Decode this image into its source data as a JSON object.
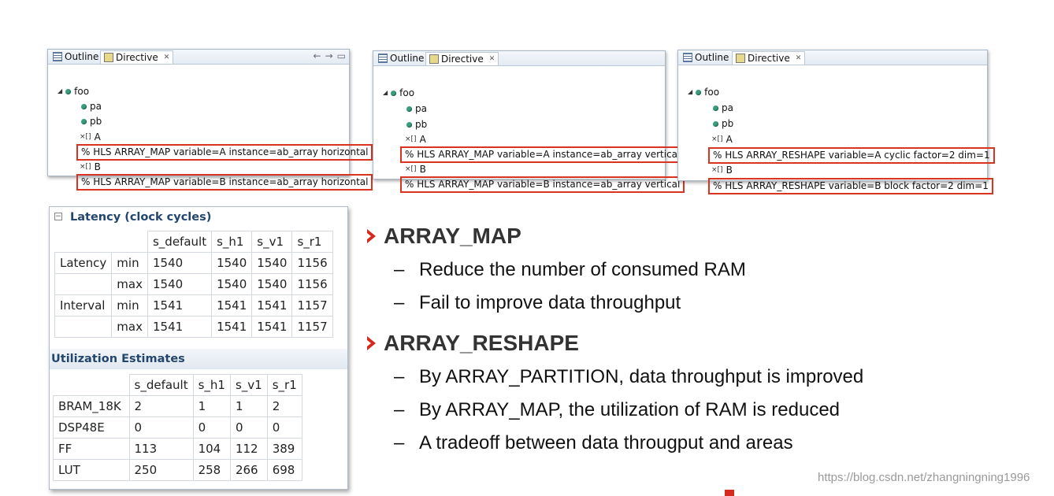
{
  "directive_panels": [
    {
      "tabs": {
        "outline": "Outline",
        "directive": "Directive"
      },
      "tree": {
        "function": "foo",
        "ports": [
          "pa",
          "pb"
        ],
        "array_a": "A",
        "array_b": "B"
      },
      "directives": [
        "HLS ARRAY_MAP variable=A instance=ab_array horizontal",
        "HLS ARRAY_MAP variable=B instance=ab_array horizontal"
      ]
    },
    {
      "tabs": {
        "outline": "Outline",
        "directive": "Directive"
      },
      "tree": {
        "function": "foo",
        "ports": [
          "pa",
          "pb"
        ],
        "array_a": "A",
        "array_b": "B"
      },
      "directives": [
        "HLS ARRAY_MAP variable=A instance=ab_array vertical",
        "HLS ARRAY_MAP variable=B instance=ab_array vertical"
      ]
    },
    {
      "tabs": {
        "outline": "Outline",
        "directive": "Directive"
      },
      "tree": {
        "function": "foo",
        "ports": [
          "pa",
          "pb"
        ],
        "array_a": "A",
        "array_b": "B"
      },
      "directives": [
        "HLS ARRAY_RESHAPE variable=A cyclic factor=2 dim=1",
        "HLS ARRAY_RESHAPE variable=B block factor=2 dim=1"
      ]
    }
  ],
  "latency": {
    "title": "Latency (clock cycles)",
    "columns": [
      "s_default",
      "s_h1",
      "s_v1",
      "s_r1"
    ],
    "rows": [
      {
        "group": "Latency",
        "sub": "min",
        "values": [
          "1540",
          "1540",
          "1540",
          "1156"
        ]
      },
      {
        "group": "",
        "sub": "max",
        "values": [
          "1540",
          "1540",
          "1540",
          "1156"
        ]
      },
      {
        "group": "Interval",
        "sub": "min",
        "values": [
          "1541",
          "1541",
          "1541",
          "1157"
        ]
      },
      {
        "group": "",
        "sub": "max",
        "values": [
          "1541",
          "1541",
          "1541",
          "1157"
        ]
      }
    ]
  },
  "utilization": {
    "title": "Utilization Estimates",
    "columns": [
      "s_default",
      "s_h1",
      "s_v1",
      "s_r1"
    ],
    "rows": [
      {
        "name": "BRAM_18K",
        "values": [
          "2",
          "1",
          "1",
          "2"
        ]
      },
      {
        "name": "DSP48E",
        "values": [
          "0",
          "0",
          "0",
          "0"
        ]
      },
      {
        "name": "FF",
        "values": [
          "113",
          "104",
          "112",
          "389"
        ]
      },
      {
        "name": "LUT",
        "values": [
          "250",
          "258",
          "266",
          "698"
        ]
      }
    ]
  },
  "bullets": [
    {
      "title": "ARRAY_MAP",
      "items": [
        "Reduce the number of consumed RAM",
        "Fail to improve data throughput"
      ]
    },
    {
      "title": "ARRAY_RESHAPE",
      "items": [
        "By ARRAY_PARTITION, data throughput is improved",
        "By ARRAY_MAP, the utilization of RAM is reduced",
        "A tradeoff between data througput and areas"
      ]
    }
  ],
  "watermark": "https://blog.csdn.net/zhangningning1996",
  "colors": {
    "accent_red": "#d62a1e",
    "section_blue": "#23466e"
  }
}
